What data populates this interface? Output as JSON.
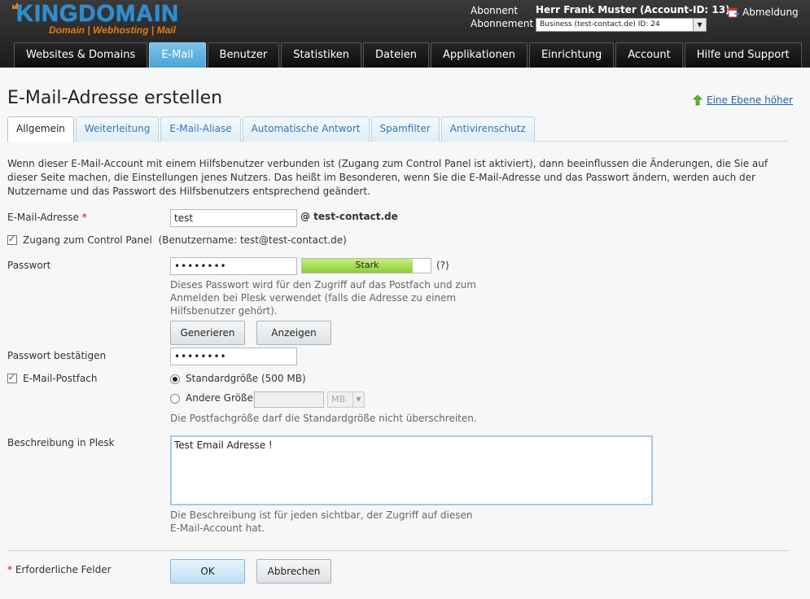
{
  "header": {
    "logo_text": "KINGDOMAIN",
    "logo_tagline": "Domain | Webhosting | Mail",
    "subscriber_label": "Abonnent",
    "subscriber_name": "Herr Frank Muster (Account-ID: 13)",
    "subscription_label": "Abonnement",
    "subscription_value": "Business (test-contact.de) ID: 24",
    "logout_label": "Abmeldung"
  },
  "nav": {
    "tabs": [
      {
        "label": "Websites & Domains"
      },
      {
        "label": "E-Mail"
      },
      {
        "label": "Benutzer"
      },
      {
        "label": "Statistiken"
      },
      {
        "label": "Dateien"
      },
      {
        "label": "Applikationen"
      },
      {
        "label": "Einrichtung"
      },
      {
        "label": "Account"
      },
      {
        "label": "Hilfe und Support"
      }
    ],
    "active": "E-Mail"
  },
  "page": {
    "title": "E-Mail-Adresse erstellen",
    "up_link": "Eine Ebene höher"
  },
  "tabs": [
    {
      "label": "Allgemein"
    },
    {
      "label": "Weiterleitung"
    },
    {
      "label": "E-Mail-Aliase"
    },
    {
      "label": "Automatische Antwort"
    },
    {
      "label": "Spamfilter"
    },
    {
      "label": "Antivirenschutz"
    }
  ],
  "intro": "Wenn dieser E-Mail-Account mit einem Hilfsbenutzer verbunden ist (Zugang zum Control Panel ist aktiviert), dann beeinflussen die Änderungen, die Sie auf dieser Seite machen, die Einstellungen jenes Nutzers. Das heißt im Besonderen, wenn Sie die E-Mail-Adresse und das Passwort ändern, werden auch der Nutzername und das Passwort des Hilfsbenutzers entsprechend geändert.",
  "form": {
    "email_label": "E-Mail-Adresse",
    "required_mark": "*",
    "email_value": "test",
    "email_domain": "@ test-contact.de",
    "control_panel_label": "Zugang zum Control Panel",
    "control_panel_hint": "(Benutzername: test@test-contact.de)",
    "password_label": "Passwort",
    "password_value": "••••••••",
    "strength_label": "Stark",
    "strength_level": 0.86,
    "strength_help": "(?)",
    "password_hint": "Dieses Passwort wird für den Zugriff auf das Postfach und zum Anmelden bei Plesk verwendet (falls die Adresse zu einem Hilfsbenutzer gehört).",
    "generate_button": "Generieren",
    "show_button": "Anzeigen",
    "password_confirm_label": "Passwort bestätigen",
    "password_confirm_value": "••••••••",
    "mailbox_label": "E-Mail-Postfach",
    "default_size_label": "Standardgröße (500 MB)",
    "other_size_label": "Andere Größe",
    "size_unit": "MB",
    "size_hint": "Die Postfachgröße darf die Standardgröße nicht überschreiten.",
    "description_label": "Beschreibung in Plesk",
    "description_value": "Test Email Adresse !",
    "description_hint": "Die Beschreibung ist für jeden sichtbar, der Zugriff auf diesen E-Mail-Account hat.",
    "required_fields_label": "Erforderliche Felder",
    "ok_button": "OK",
    "cancel_button": "Abbrechen"
  },
  "colors": {
    "accent_blue": "#4aa3d6",
    "strength_green": "#8fcc3a",
    "link_blue": "#1e64a8",
    "logo_orange": "#e17a17"
  }
}
